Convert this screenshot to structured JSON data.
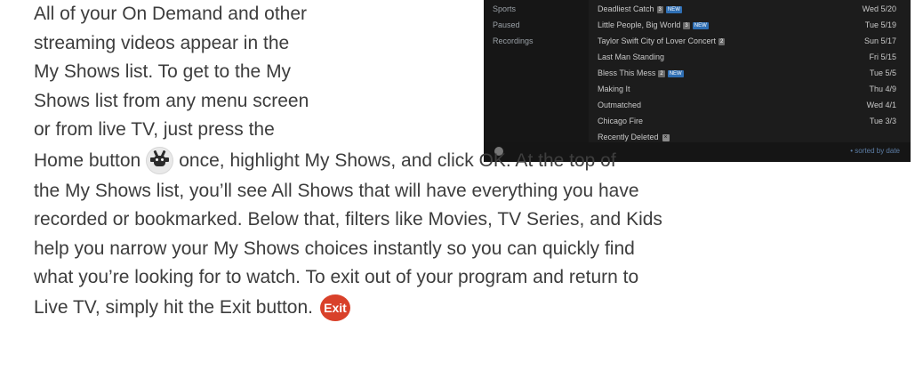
{
  "paragraph": {
    "lines_top": [
      "All of your On Demand and other",
      "streaming videos appear in the",
      "My Shows list. To get to the My",
      "Shows list from any  menu screen",
      "or from live TV, just press the"
    ],
    "line_home_before": "Home button",
    "line_home_after": "once, highlight My Shows, and click OK.  At the top of",
    "lines_body": [
      "the My Shows list, you’ll see All Shows that will have everything you have",
      "recorded or bookmarked. Below that, filters like Movies, TV Series, and Kids",
      "help you narrow your My Shows choices instantly so you can quickly find",
      "what you’re looking for to watch.  To exit out of your program and return to"
    ],
    "line_exit_before": "Live TV, simply hit the Exit button.",
    "exit_label": "Exit"
  },
  "tv_screen": {
    "sidebar": [
      "Sports",
      "Paused",
      "Recordings"
    ],
    "shows": [
      {
        "title": "Deadliest Catch",
        "count": "3",
        "new": "NEW",
        "date": "Wed 5/20"
      },
      {
        "title": "Little People, Big World",
        "count": "3",
        "new": "NEW",
        "date": "Tue 5/19"
      },
      {
        "title": "Taylor Swift City of Lover Concert",
        "count": "2",
        "new": "",
        "date": "Sun 5/17"
      },
      {
        "title": "Last Man Standing",
        "count": "",
        "new": "",
        "date": "Fri 5/15"
      },
      {
        "title": "Bless This Mess",
        "count": "2",
        "new": "NEW",
        "date": "Tue 5/5"
      },
      {
        "title": "Making It",
        "count": "",
        "new": "",
        "date": "Thu 4/9"
      },
      {
        "title": "Outmatched",
        "count": "",
        "new": "",
        "date": "Wed 4/1"
      },
      {
        "title": "Chicago Fire",
        "count": "",
        "new": "",
        "date": "Tue 3/3"
      },
      {
        "title": "Recently Deleted",
        "count": "",
        "new": "",
        "date": ""
      }
    ],
    "sort_label": "• sorted by date",
    "colors": {
      "new_badge": "#2f6fb4",
      "background": "#1c1c1c",
      "sort_text": "#5d7ea6"
    }
  },
  "icons": {
    "home": "tivo-home-icon",
    "exit": "exit-button-icon",
    "delete": "x-icon"
  }
}
